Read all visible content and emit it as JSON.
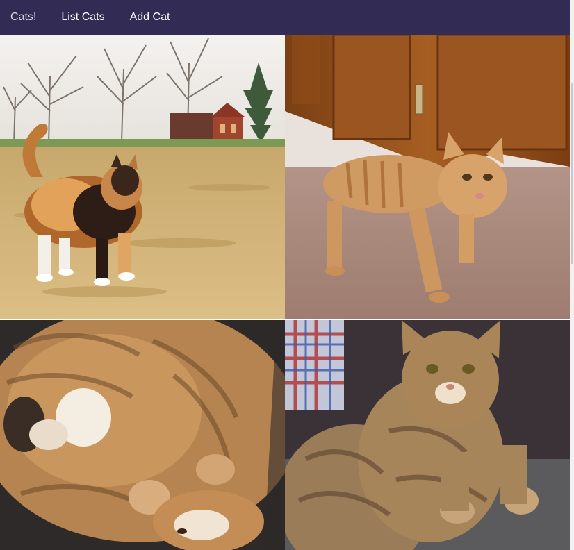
{
  "navbar": {
    "brand": "Cats!",
    "links": [
      {
        "label": "List Cats"
      },
      {
        "label": "Add Cat"
      }
    ],
    "background": "#322c54"
  },
  "cats": [
    {
      "photo": "calico-cat-in-field"
    },
    {
      "photo": "orange-tabby-under-cabinet"
    },
    {
      "photo": "fluffy-cat-curled-up"
    },
    {
      "photo": "tabby-cat-sitting"
    }
  ]
}
